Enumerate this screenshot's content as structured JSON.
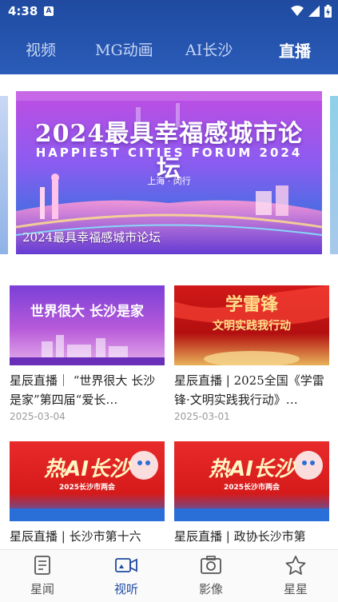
{
  "status": {
    "time": "4:38",
    "badge": "A"
  },
  "tabs": [
    {
      "label": "视频"
    },
    {
      "label": "MG动画"
    },
    {
      "label": "AI长沙"
    },
    {
      "label": "直播"
    }
  ],
  "hero": {
    "title": "2024最具幸福感城市论坛",
    "subtitle": "HAPPIEST CITIES FORUM 2024",
    "location": "上海 · 闵行",
    "caption": "2024最具幸福感城市论坛"
  },
  "cards": [
    {
      "thumb_text": "世界很大 长沙是家",
      "title": "星辰直播｜ “世界很大 长沙是家”第四届“爱长…",
      "date": "2025-03-04"
    },
    {
      "thumb_text": "学雷锋",
      "thumb_text2": "文明实践我行动",
      "title": "星辰直播 | 2025全国《学雷锋·文明实践我行动》…",
      "date": "2025-03-01"
    },
    {
      "thumb_text": "热AI长沙",
      "thumb_text2": "2025长沙市两会",
      "title": "星辰直播 | 长沙市第十六",
      "date": ""
    },
    {
      "thumb_text": "热AI长沙",
      "thumb_text2": "2025长沙市两会",
      "title": "星辰直播 | 政协长沙市第",
      "date": ""
    }
  ],
  "bottom_nav": [
    {
      "label": "星闻",
      "icon": "news-icon"
    },
    {
      "label": "视听",
      "icon": "video-icon"
    },
    {
      "label": "影像",
      "icon": "image-icon"
    },
    {
      "label": "星星",
      "icon": "star-icon"
    }
  ],
  "colors": {
    "brand": "#1f4aa0",
    "active_nav": "#1f4aa0",
    "inactive": "#555555"
  }
}
